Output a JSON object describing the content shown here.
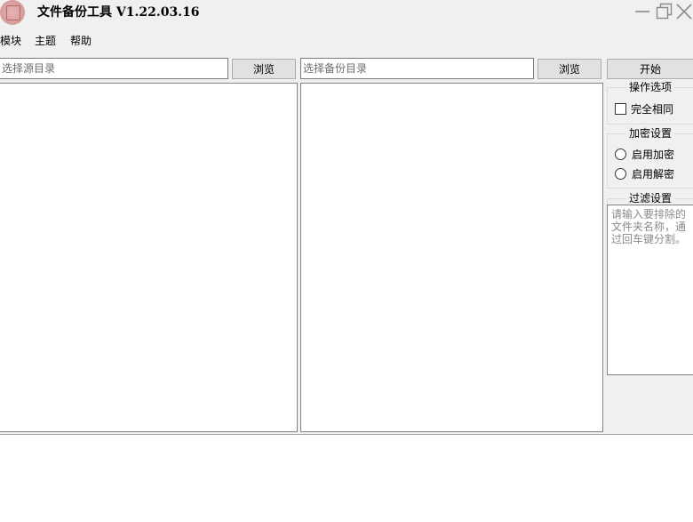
{
  "window": {
    "title": "文件备份工具 V1.22.03.16",
    "controls": [
      "minimize-icon",
      "restore-icon",
      "close-icon"
    ]
  },
  "menu": {
    "items": [
      {
        "label": "模块"
      },
      {
        "label": "主题"
      },
      {
        "label": "帮助"
      }
    ]
  },
  "source": {
    "placeholder": "选择源目录",
    "browse_label": "浏览"
  },
  "backup": {
    "placeholder": "选择备份目录",
    "browse_label": "浏览"
  },
  "start_label": "开始",
  "options": {
    "title": "操作选项",
    "exact_match_label": "完全相同",
    "exact_match_checked": false
  },
  "encryption": {
    "title": "加密设置",
    "enable_encrypt_label": "启用加密",
    "enable_decrypt_label": "启用解密"
  },
  "filter": {
    "title": "过滤设置",
    "placeholder": "请输入要排除的文件夹名称，通过回车键分割。"
  },
  "colors": {
    "window_bg": "#f0f0f0",
    "button_bg": "#e1e1e1",
    "border": "#7a7a7a",
    "icon_accent": "#d69a9a"
  }
}
